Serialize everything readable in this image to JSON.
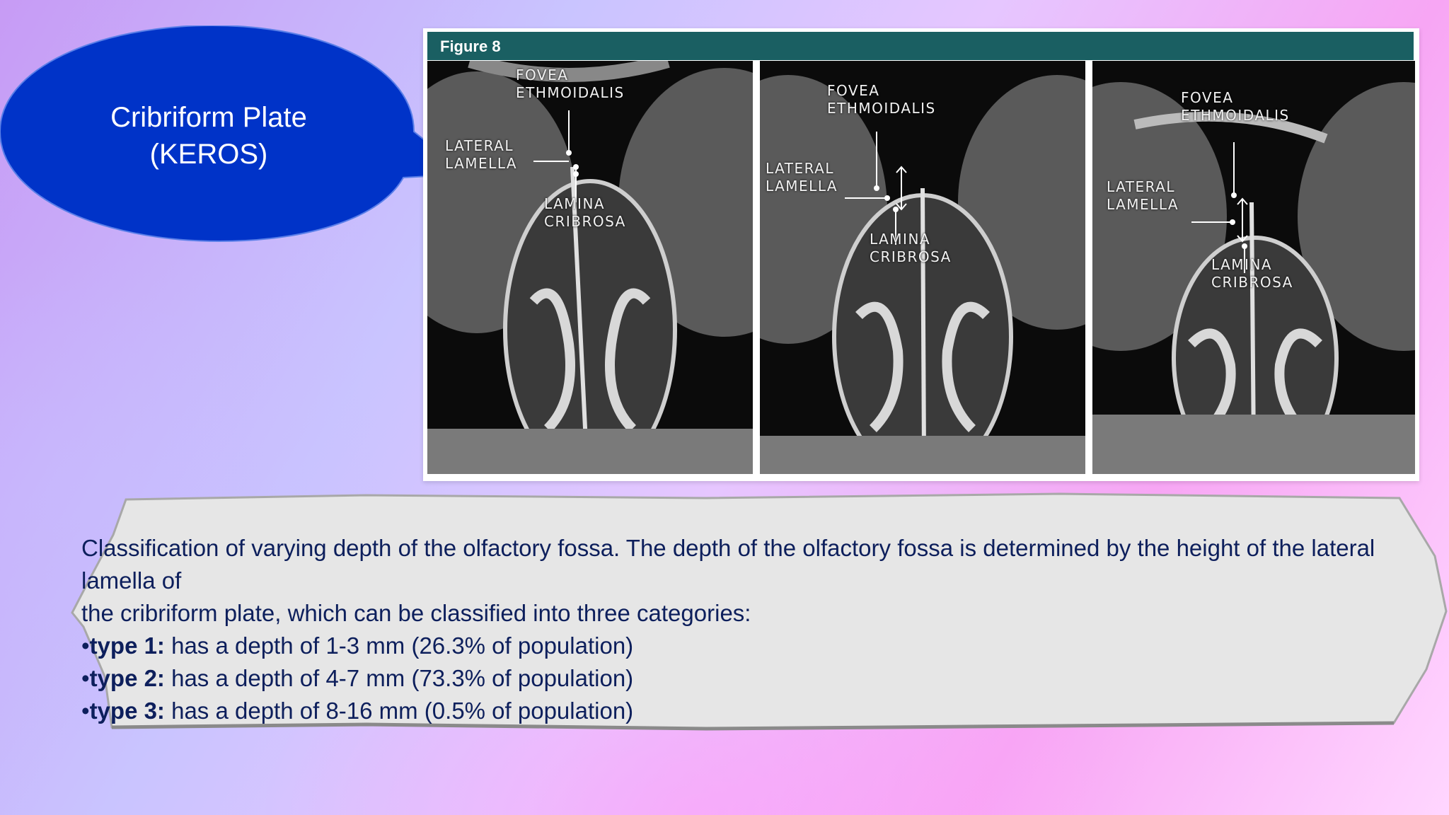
{
  "callout": {
    "line1": "Cribriform Plate",
    "line2": "(KEROS)",
    "color": "#0033c8"
  },
  "figure": {
    "title": "Figure 8",
    "header_color": "#1a5f62",
    "panels": [
      {
        "fovea_1": "FOVEA",
        "fovea_2": "ETHMOIDALIS",
        "lateral_1": "LATERAL",
        "lateral_2": "LAMELLA",
        "lamina_1": "LAMINA",
        "lamina_2": "CRIBROSA"
      },
      {
        "fovea_1": "FOVEA",
        "fovea_2": "ETHMOIDALIS",
        "lateral_1": "LATERAL",
        "lateral_2": "LAMELLA",
        "lamina_1": "LAMINA",
        "lamina_2": "CRIBROSA"
      },
      {
        "fovea_1": "FOVEA",
        "fovea_2": "ETHMOIDALIS",
        "lateral_1": "LATERAL",
        "lateral_2": "LAMELLA",
        "lamina_1": "LAMINA",
        "lamina_2": "CRIBROSA"
      }
    ]
  },
  "description": {
    "intro_1": "Classification of varying depth of the olfactory fossa. The depth of the olfactory fossa is determined by the height of the lateral lamella of",
    "intro_2": "the cribriform plate, which can be classified into three categories:",
    "types": [
      {
        "label": "type 1:",
        "text": " has a depth of 1-3 mm (26.3% of population)"
      },
      {
        "label": "type 2:",
        "text": " has a depth of 4-7 mm (73.3% of population)"
      },
      {
        "label": "type 3:",
        "text": " has a depth of 8-16 mm (0.5% of population)"
      }
    ],
    "text_color": "#0d1f5c"
  }
}
